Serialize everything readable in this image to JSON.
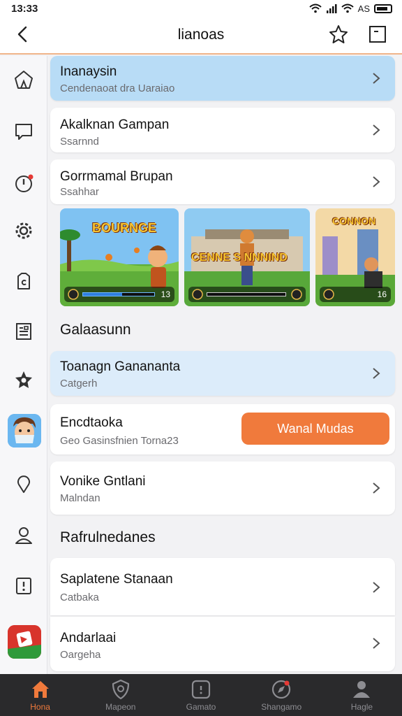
{
  "status": {
    "time": "13:33",
    "signal_text": "AS"
  },
  "header": {
    "title": "lianoas"
  },
  "list_top": [
    {
      "title": "Inanaysin",
      "subtitle": "Cendenaoat dra Uaraiao"
    },
    {
      "title": "Akalknan Gampan",
      "subtitle": "Ssarnnd"
    },
    {
      "title": "Gorrmamal Brupan",
      "subtitle": "Ssahhar"
    }
  ],
  "game_cards": [
    {
      "title": "BOURNGE",
      "count": "13",
      "bar_fraction": 0.55
    },
    {
      "title": "CENNE S NNNIND",
      "count": "",
      "bar_fraction": 0.0
    },
    {
      "title": "CONNON",
      "count": "16",
      "bar_fraction": 0.0
    }
  ],
  "section1": {
    "heading": "Galaasunn"
  },
  "list_mid": [
    {
      "title": "Toanagn Ganananta",
      "subtitle": "Catgerh"
    },
    {
      "title": "Encdtaoka",
      "subtitle": "Geo  Gasinsfnien Torna23",
      "button": "Wanal Mudas"
    },
    {
      "title": "Vonike Gntlani",
      "subtitle": "Malndan"
    }
  ],
  "section2": {
    "heading": "Rafrulnedanes"
  },
  "list_bottom": [
    {
      "title": "Saplatene Stanaan",
      "subtitle": "Catbaka"
    },
    {
      "title": "Andarlaai",
      "subtitle": "Oargeha"
    }
  ],
  "bottom_nav": [
    {
      "label": "Hona",
      "icon": "home-icon",
      "active": true
    },
    {
      "label": "Mapeon",
      "icon": "shield-icon",
      "active": false
    },
    {
      "label": "Gamato",
      "icon": "gamepad-icon",
      "active": false
    },
    {
      "label": "Shangamo",
      "icon": "compass-icon",
      "active": false
    },
    {
      "label": "Hagle",
      "icon": "person-icon",
      "active": false
    }
  ],
  "colors": {
    "accent": "#f07a3c",
    "highlight_row": "#b8dcf6",
    "nav_bg": "#2a2a2c"
  }
}
